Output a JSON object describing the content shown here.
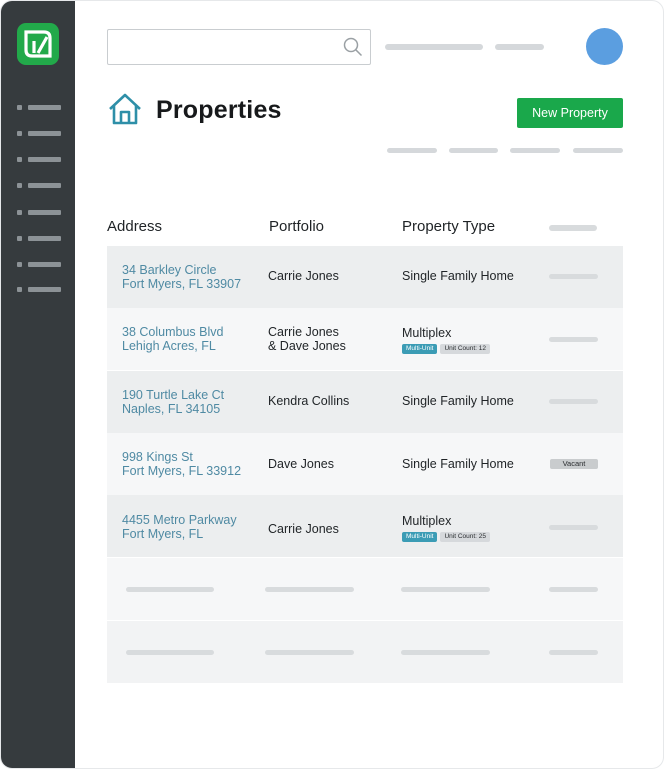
{
  "search": {
    "placeholder": "",
    "value": ""
  },
  "page": {
    "title": "Properties",
    "new_button_label": "New Property"
  },
  "table": {
    "columns": [
      "Address",
      "Portfolio",
      "Property Type"
    ],
    "rows": [
      {
        "address_line1": "34 Barkley Circle",
        "address_line2": "Fort Myers, FL 33907",
        "portfolio_line1": "Carrie Jones",
        "portfolio_line2": "",
        "property_type": "Single Family Home",
        "badges": [],
        "status": ""
      },
      {
        "address_line1": "38 Columbus Blvd",
        "address_line2": "Lehigh Acres, FL",
        "portfolio_line1": "Carrie Jones",
        "portfolio_line2": "& Dave Jones",
        "property_type": "Multiplex",
        "badges": [
          "Multi-Unit",
          "Unit Count: 12"
        ],
        "status": ""
      },
      {
        "address_line1": "190 Turtle Lake Ct",
        "address_line2": "Naples, FL 34105",
        "portfolio_line1": "Kendra Collins",
        "portfolio_line2": "",
        "property_type": "Single Family Home",
        "badges": [],
        "status": ""
      },
      {
        "address_line1": "998 Kings St",
        "address_line2": "Fort Myers, FL 33912",
        "portfolio_line1": "Dave Jones",
        "portfolio_line2": "",
        "property_type": "Single Family Home",
        "badges": [],
        "status": "Vacant"
      },
      {
        "address_line1": "4455 Metro Parkway",
        "address_line2": "Fort Myers, FL",
        "portfolio_line1": "Carrie Jones",
        "portfolio_line2": "",
        "property_type": "Multiplex",
        "badges": [
          "Multi-Unit",
          "Unit Count: 25"
        ],
        "status": ""
      }
    ]
  },
  "icons": {
    "logo": "brand-logo-icon",
    "search": "search-icon",
    "home": "home-icon",
    "avatar": "user-avatar"
  },
  "colors": {
    "sidebar": "#363b3e",
    "brand_green": "#1aa84b",
    "address_link": "#4f8aa3",
    "multi_unit_badge": "#3b9cb5",
    "avatar": "#5b9ee0",
    "home_icon": "#2e8fa8"
  }
}
